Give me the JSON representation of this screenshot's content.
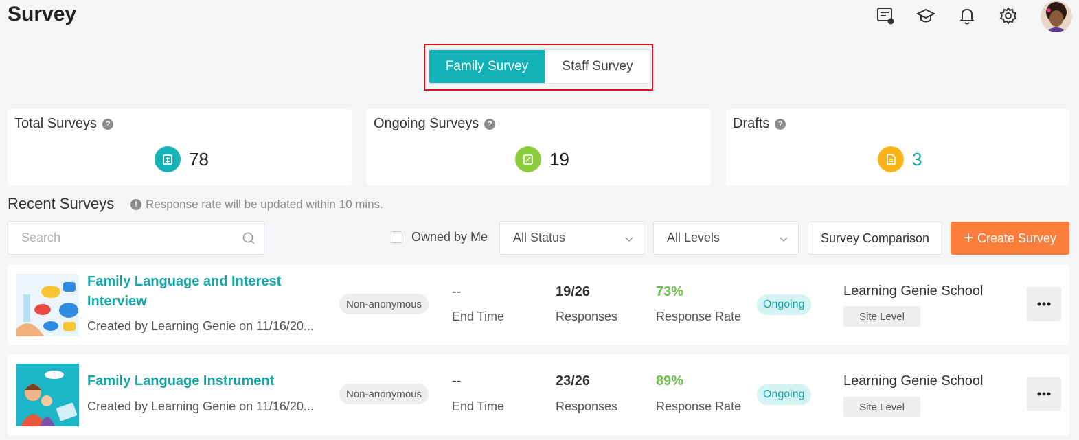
{
  "header": {
    "title": "Survey",
    "icons": [
      "feedback-icon",
      "graduation-cap-icon",
      "bell-icon",
      "gear-icon",
      "avatar"
    ]
  },
  "tabs": {
    "family_label": "Family Survey",
    "staff_label": "Staff Survey",
    "active": "Family Survey"
  },
  "stats": {
    "total": {
      "label": "Total Surveys",
      "value": "78",
      "color": "#16b3b8"
    },
    "ongoing": {
      "label": "Ongoing Surveys",
      "value": "19",
      "color": "#8ccc3f"
    },
    "drafts": {
      "label": "Drafts",
      "value": "3",
      "color": "#fbb418"
    }
  },
  "recent": {
    "heading": "Recent Surveys",
    "note": "Response rate will be updated within 10 mins."
  },
  "filters": {
    "search_placeholder": "Search",
    "owned_label": "Owned by Me",
    "status_value": "All Status",
    "levels_value": "All Levels",
    "compare_label": "Survey Comparison",
    "create_label": "Create Survey"
  },
  "surveys": [
    {
      "title": "Family Language and Interest Interview",
      "created": "Created by Learning Genie on 11/16/20...",
      "anonymity": "Non-anonymous",
      "end_time_value": "--",
      "end_time_label": "End Time",
      "responses_value": "19/26",
      "responses_label": "Responses",
      "rate_value": "73%",
      "rate_label": "Response Rate",
      "status": "Ongoing",
      "school": "Learning Genie School",
      "level": "Site Level"
    },
    {
      "title": "Family Language Instrument",
      "created": "Created by Learning Genie on 11/16/20...",
      "anonymity": "Non-anonymous",
      "end_time_value": "--",
      "end_time_label": "End Time",
      "responses_value": "23/26",
      "responses_label": "Responses",
      "rate_value": "89%",
      "rate_label": "Response Rate",
      "status": "Ongoing",
      "school": "Learning Genie School",
      "level": "Site Level"
    }
  ],
  "colors": {
    "accent": "#12b1b6",
    "create_button": "#fd7e3c",
    "highlight_border": "#e0121b",
    "rate_green": "#6cc04a"
  }
}
